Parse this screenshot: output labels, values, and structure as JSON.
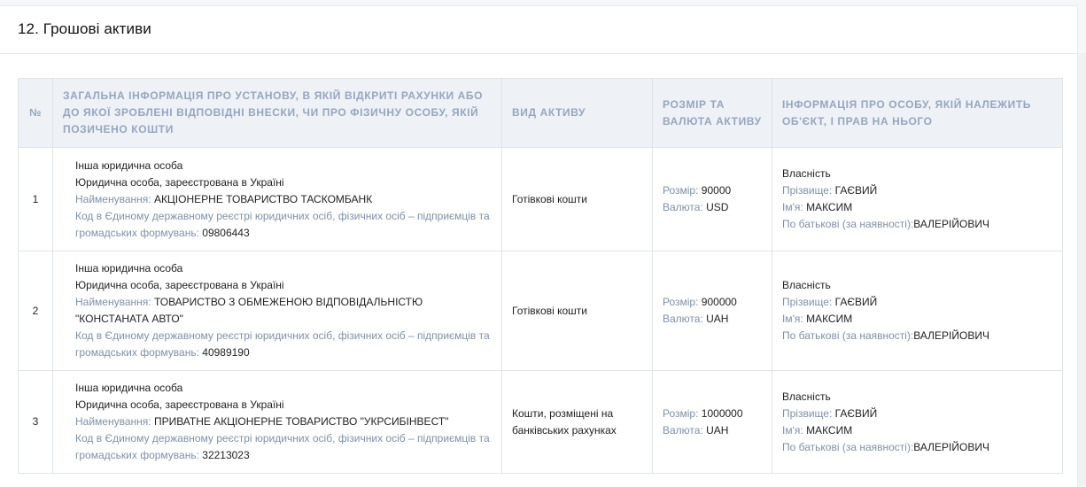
{
  "section": {
    "title": "12. Грошові активи"
  },
  "table": {
    "columns": [
      "№",
      "Загальна інформація про установу, в якій відкриті рахунки або до якої зроблені відповідні внески, чи про фізичну особу, якій позичено кошти",
      "Вид активу",
      "Розмір та валюта активу",
      "Інформація про особу, якій належить об'єкт, і прав на нього"
    ],
    "rows": [
      {
        "num": "1",
        "inst_type": "Інша юридична особа",
        "inst_status": "Юридична особа, зареєстрована в Україні",
        "name_label": "Найменування:",
        "name": "АКЦІОНЕРНЕ ТОВАРИСТВО ТАСКОМБАНК",
        "code_label": "Код в Єдиному державному реєстрі юридичних осіб, фізичних осіб – підприємців та громадських формувань:",
        "code": "09806443",
        "asset_type": "Готівкові кошти",
        "size_label": "Розмір:",
        "size": "90000",
        "currency_label": "Валюта:",
        "currency": "USD",
        "ownership": "Власність",
        "surname_label": "Прізвище:",
        "surname": "ГАЄВИЙ",
        "firstname_label": "Ім'я:",
        "firstname": "МАКСИМ",
        "patronymic_label": "По батькові (за наявності):",
        "patronymic": "ВАЛЕРІЙОВИЧ"
      },
      {
        "num": "2",
        "inst_type": "Інша юридична особа",
        "inst_status": "Юридична особа, зареєстрована в Україні",
        "name_label": "Найменування:",
        "name": "ТОВАРИСТВО З ОБМЕЖЕНОЮ ВІДПОВІДАЛЬНІСТЮ \"КОНСТАНАТА АВТО\"",
        "code_label": "Код в Єдиному державному реєстрі юридичних осіб, фізичних осіб – підприємців та громадських формувань:",
        "code": "40989190",
        "asset_type": "Готівкові кошти",
        "size_label": "Розмір:",
        "size": "900000",
        "currency_label": "Валюта:",
        "currency": "UAH",
        "ownership": "Власність",
        "surname_label": "Прізвище:",
        "surname": "ГАЄВИЙ",
        "firstname_label": "Ім'я:",
        "firstname": "МАКСИМ",
        "patronymic_label": "По батькові (за наявності):",
        "patronymic": "ВАЛЕРІЙОВИЧ"
      },
      {
        "num": "3",
        "inst_type": "Інша юридична особа",
        "inst_status": "Юридична особа, зареєстрована в Україні",
        "name_label": "Найменування:",
        "name": "ПРИВАТНЕ АКЦІОНЕРНЕ ТОВАРИСТВО \"УКРСИБІНВЕСТ\"",
        "code_label": "Код в Єдиному державному реєстрі юридичних осіб, фізичних осіб – підприємців та громадських формувань:",
        "code": "32213023",
        "asset_type": "Кошти, розміщені на банківських рахунках",
        "size_label": "Розмір:",
        "size": "1000000",
        "currency_label": "Валюта:",
        "currency": "UAH",
        "ownership": "Власність",
        "surname_label": "Прізвище:",
        "surname": "ГАЄВИЙ",
        "firstname_label": "Ім'я:",
        "firstname": "МАКСИМ",
        "patronymic_label": "По батькові (за наявності):",
        "patronymic": "ВАЛЕРІЙОВИЧ"
      }
    ]
  }
}
